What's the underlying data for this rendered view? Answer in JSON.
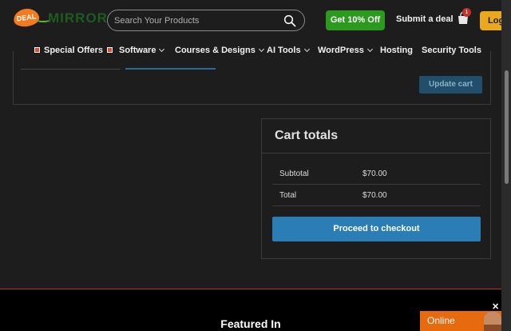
{
  "header": {
    "logo_badge": "DEAL",
    "logo_text": "MIRROR",
    "search_placeholder": "Search Your Products",
    "offer_button": "Get 10% Off",
    "submit_deal": "Submit a deal",
    "cart_count": "1",
    "login": "Login",
    "colors": {
      "offer": "#2c9a1f",
      "login": "#e9a81e",
      "logo": "#f47a20"
    }
  },
  "nav": {
    "items": [
      {
        "label": "Special Offers",
        "dropdown": false
      },
      {
        "label": "Software",
        "dropdown": true
      },
      {
        "label": "Courses & Designs",
        "dropdown": true
      },
      {
        "label": "AI Tools",
        "dropdown": true
      },
      {
        "label": "WordPress",
        "dropdown": true
      },
      {
        "label": "Hosting",
        "dropdown": false
      },
      {
        "label": "Security Tools",
        "dropdown": false
      }
    ]
  },
  "cart": {
    "update_button": "Update cart"
  },
  "totals": {
    "title": "Cart totals",
    "rows": [
      {
        "label": "Subtotal",
        "value": "$70.00"
      },
      {
        "label": "Total",
        "value": "$70.00"
      }
    ],
    "checkout_button": "Proceed to checkout",
    "accent": "#2a7db5"
  },
  "footer": {
    "featured": "Featured In"
  },
  "chat": {
    "label": "Online",
    "close": "✕",
    "color": "#e86a0e"
  }
}
